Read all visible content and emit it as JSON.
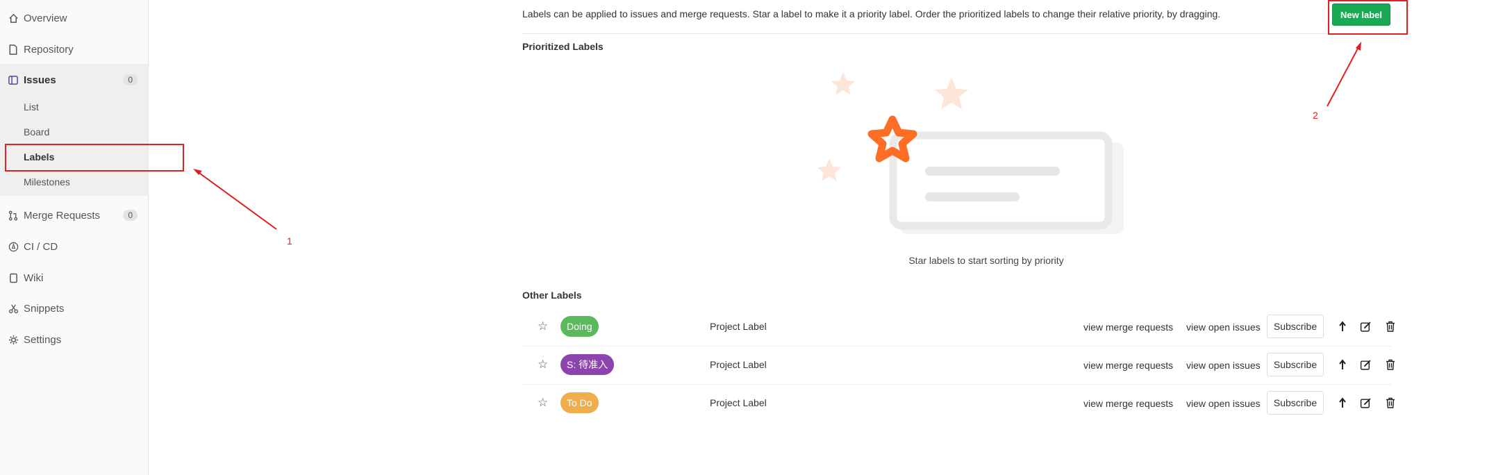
{
  "sidebar": {
    "overview": "Overview",
    "repository": "Repository",
    "issues": "Issues",
    "issues_count": "0",
    "list": "List",
    "board": "Board",
    "labels": "Labels",
    "milestones": "Milestones",
    "merge_requests": "Merge Requests",
    "merge_requests_count": "0",
    "cicd": "CI / CD",
    "wiki": "Wiki",
    "snippets": "Snippets",
    "settings": "Settings"
  },
  "main": {
    "description": "Labels can be applied to issues and merge requests. Star a label to make it a priority label. Order the prioritized labels to change their relative priority, by dragging.",
    "new_label_button": "New label",
    "prioritized_title": "Prioritized Labels",
    "empty_state_text": "Star labels to start sorting by priority",
    "other_title": "Other Labels"
  },
  "labels": [
    {
      "name": "Doing",
      "color": "#5cb85c",
      "type": "Project Label",
      "view_mr": "view merge requests",
      "view_issues": "view open issues",
      "subscribe": "Subscribe"
    },
    {
      "name": "S: 待准入",
      "color": "#8e44ad",
      "type": "Project Label",
      "view_mr": "view merge requests",
      "view_issues": "view open issues",
      "subscribe": "Subscribe"
    },
    {
      "name": "To Do",
      "color": "#f0ad4e",
      "type": "Project Label",
      "view_mr": "view merge requests",
      "view_issues": "view open issues",
      "subscribe": "Subscribe"
    }
  ],
  "annotations": {
    "one": "1",
    "two": "2",
    "color": "#e02020"
  }
}
